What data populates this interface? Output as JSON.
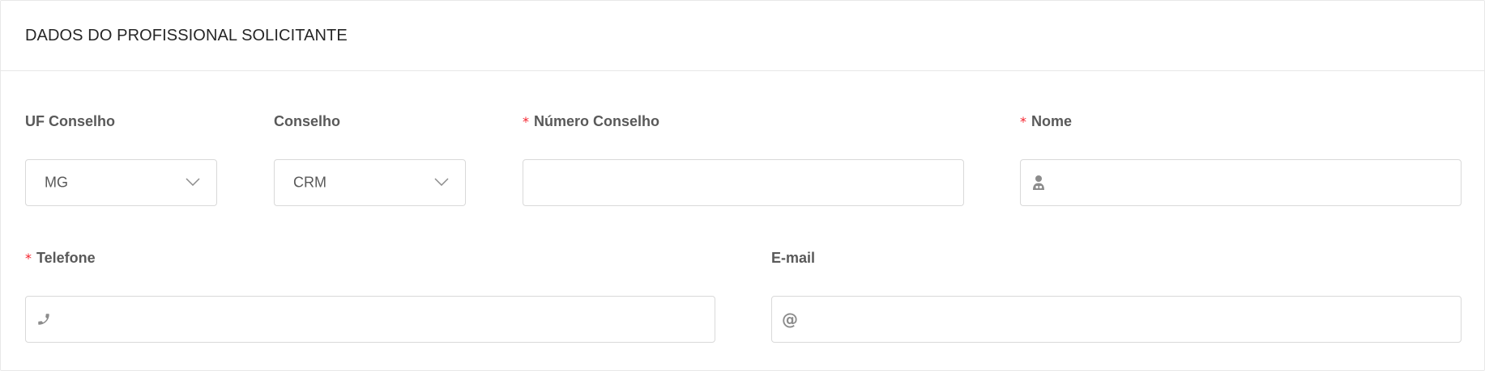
{
  "section": {
    "title": "DADOS DO PROFISSIONAL SOLICITANTE"
  },
  "fields": {
    "uf_conselho": {
      "label": "UF Conselho",
      "value": "MG"
    },
    "conselho": {
      "label": "Conselho",
      "value": "CRM"
    },
    "numero_conselho": {
      "label": "Número Conselho",
      "required": "*",
      "value": ""
    },
    "nome": {
      "label": "Nome",
      "required": "*",
      "value": "",
      "icon": "user-doctor-icon"
    },
    "telefone": {
      "label": "Telefone",
      "required": "*",
      "value": "",
      "icon": "phone-icon"
    },
    "email": {
      "label": "E-mail",
      "value": "",
      "icon_glyph": "@"
    }
  },
  "colors": {
    "required": "#f5222d",
    "label": "#595959",
    "border": "#d9d9d9",
    "icon": "#8c8c8c"
  }
}
